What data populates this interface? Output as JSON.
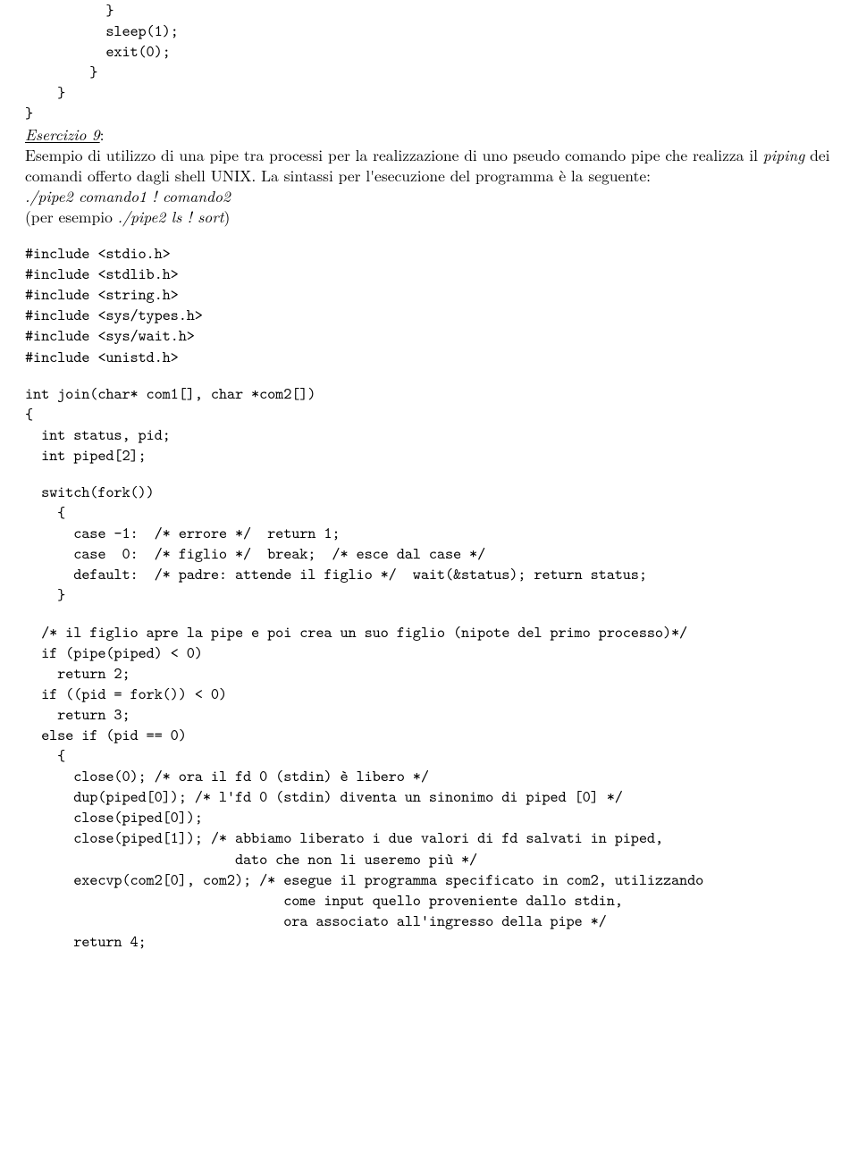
{
  "code_snippet_top": "          }\n          sleep(1);\n          exit(0);\n        }\n    }\n}",
  "exercise_label": "Esercizio 9",
  "exercise_label_suffix": ":",
  "prose_before_italic1": "Esempio di utilizzo di una pipe tra processi per la realizzazione di uno pseudo comando pipe che realizza il ",
  "italic1": "piping",
  "prose_after_italic1": " dei comandi offerto dagli shell UNIX. La sintassi per l'esecuzione del programma è la seguente:",
  "usage_line": "./pipe2 comando1 ! comando2",
  "example_before": "(per esempio ",
  "example_italic": "./pipe2 ls ! sort",
  "example_after": ")",
  "code_includes": "#include <stdio.h>\n#include <stdlib.h>\n#include <string.h>\n#include <sys/types.h>\n#include <sys/wait.h>\n#include <unistd.h>",
  "code_func_header": "int join(char* com1[], char *com2[])\n{\n  int status, pid;\n  int piped[2];",
  "code_switch": "  switch(fork())\n    {\n      case -1:  /* errore */  return 1;\n      case  0:  /* figlio */  break;  /* esce dal case */\n      default:  /* padre: attende il figlio */  wait(&status); return status;\n    }",
  "code_child": "  /* il figlio apre la pipe e poi crea un suo figlio (nipote del primo processo)*/\n  if (pipe(piped) < 0)\n    return 2;\n  if ((pid = fork()) < 0)\n    return 3;\n  else if (pid == 0)\n    {\n      close(0); /* ora il fd 0 (stdin) è libero */\n      dup(piped[0]); /* l'fd 0 (stdin) diventa un sinonimo di piped [0] */\n      close(piped[0]);\n      close(piped[1]); /* abbiamo liberato i due valori di fd salvati in piped,\n                          dato che non li useremo più */\n      execvp(com2[0], com2); /* esegue il programma specificato in com2, utilizzando\n                                come input quello proveniente dallo stdin,\n                                ora associato all'ingresso della pipe */\n      return 4;"
}
